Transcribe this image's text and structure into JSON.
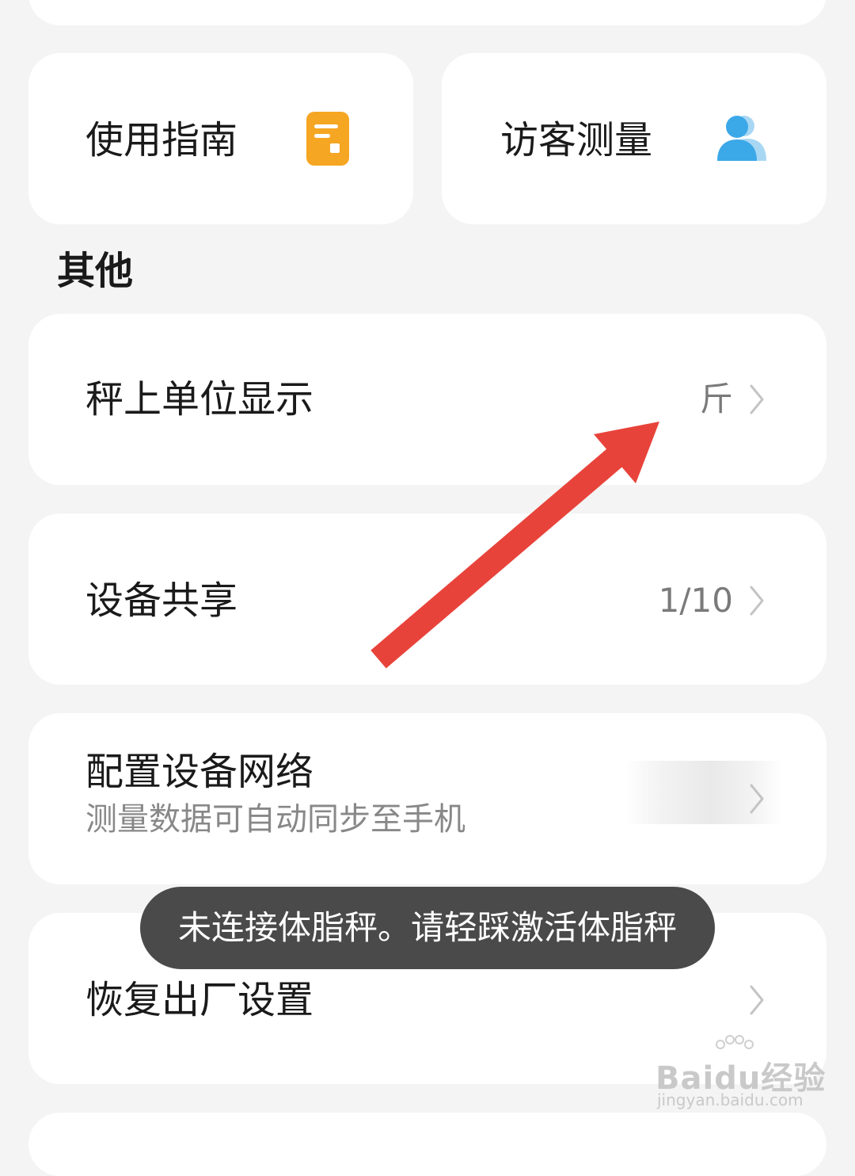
{
  "tiles": {
    "guide_label": "使用指南",
    "guide_icon": "document-icon",
    "guide_icon_color": "#F5A623",
    "visitor_label": "访客测量",
    "visitor_icon": "people-icon",
    "visitor_icon_color": "#3BA8E8"
  },
  "section": {
    "title": "其他"
  },
  "rows": [
    {
      "title": "秤上单位显示",
      "value": "斤"
    },
    {
      "title": "设备共享",
      "value": "1/10"
    },
    {
      "title": "配置设备网络",
      "subtitle": "测量数据可自动同步至手机"
    },
    {
      "title": "恢复出厂设置"
    }
  ],
  "toast": {
    "text": "未连接体脂秤。请轻踩激活体脂秤"
  },
  "annotation": {
    "arrow_color": "#E8433A"
  },
  "watermark": {
    "text": "Baidu经验",
    "url": "jingyan.baidu.com"
  }
}
